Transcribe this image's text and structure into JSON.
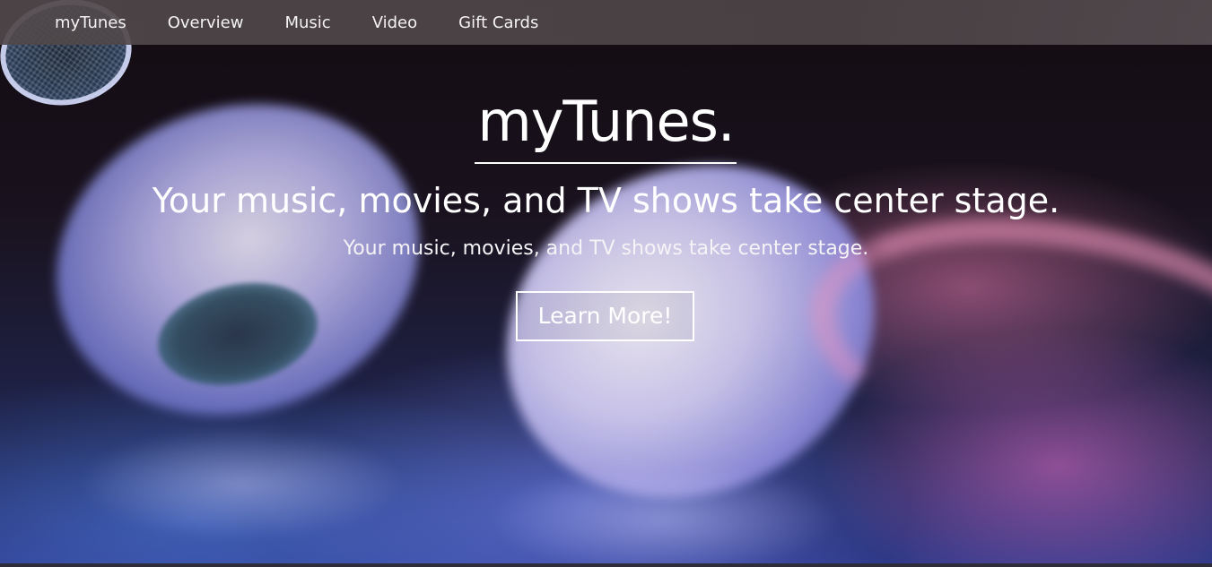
{
  "nav": {
    "items": [
      {
        "label": "myTunes"
      },
      {
        "label": "Overview"
      },
      {
        "label": "Music"
      },
      {
        "label": "Video"
      },
      {
        "label": "Gift Cards"
      }
    ]
  },
  "hero": {
    "brand": "myTunes.",
    "headline": "Your music, movies, and TV shows take center stage.",
    "subhead": "Your music, movies, and TV shows take center stage.",
    "cta_label": "Learn More!",
    "background_image": "earbuds-photo"
  },
  "colors": {
    "text": "#ffffff",
    "navbar": "#4f4749"
  }
}
